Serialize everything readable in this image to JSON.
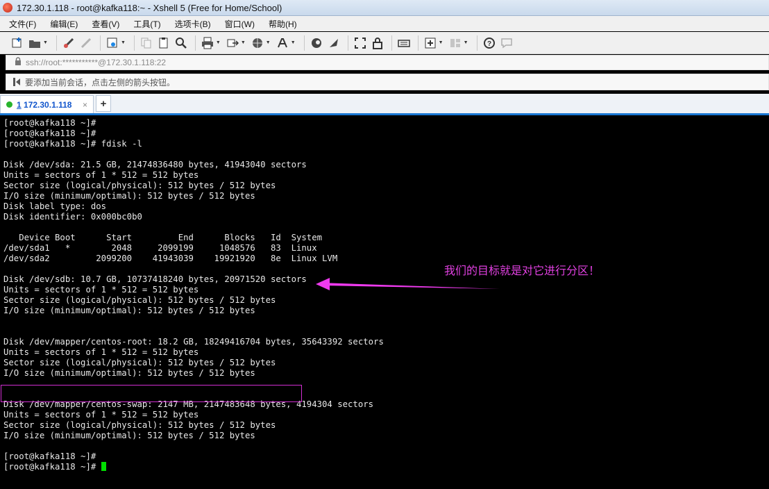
{
  "window": {
    "title": "172.30.1.118 - root@kafka118:~ - Xshell 5 (Free for Home/School)"
  },
  "menu": [
    "文件(F)",
    "编辑(E)",
    "查看(V)",
    "工具(T)",
    "选项卡(B)",
    "窗口(W)",
    "帮助(H)"
  ],
  "toolbar": {
    "icons": [
      "new-session-icon",
      "open-folder-icon",
      "connect-icon",
      "disconnect-icon",
      "properties-icon",
      "copy-icon",
      "paste-icon",
      "find-icon",
      "print-icon",
      "transfer-icon",
      "globe-icon",
      "font-icon",
      "xftp-icon",
      "xmanager-icon",
      "fullscreen-icon",
      "lock-icon",
      "keyboard-icon",
      "compose-icon",
      "layout-icon",
      "help-icon",
      "chat-icon"
    ]
  },
  "address": {
    "text": "ssh://root:***********@172.30.1.118:22"
  },
  "hint": {
    "text": "要添加当前会话，点击左侧的箭头按钮。"
  },
  "tabs": [
    {
      "number": "1",
      "label": "172.30.1.118",
      "close": "×"
    }
  ],
  "tab_add": "+",
  "terminal": {
    "lines": [
      "[root@kafka118 ~]#",
      "[root@kafka118 ~]#",
      "[root@kafka118 ~]# fdisk -l",
      "",
      "Disk /dev/sda: 21.5 GB, 21474836480 bytes, 41943040 sectors",
      "Units = sectors of 1 * 512 = 512 bytes",
      "Sector size (logical/physical): 512 bytes / 512 bytes",
      "I/O size (minimum/optimal): 512 bytes / 512 bytes",
      "Disk label type: dos",
      "Disk identifier: 0x000bc0b0",
      "",
      "   Device Boot      Start         End      Blocks   Id  System",
      "/dev/sda1   *        2048     2099199     1048576   83  Linux",
      "/dev/sda2         2099200    41943039    19921920   8e  Linux LVM",
      "",
      "Disk /dev/sdb: 10.7 GB, 10737418240 bytes, 20971520 sectors",
      "Units = sectors of 1 * 512 = 512 bytes",
      "Sector size (logical/physical): 512 bytes / 512 bytes",
      "I/O size (minimum/optimal): 512 bytes / 512 bytes",
      "",
      "",
      "Disk /dev/mapper/centos-root: 18.2 GB, 18249416704 bytes, 35643392 sectors",
      "Units = sectors of 1 * 512 = 512 bytes",
      "Sector size (logical/physical): 512 bytes / 512 bytes",
      "I/O size (minimum/optimal): 512 bytes / 512 bytes",
      "",
      "",
      "Disk /dev/mapper/centos-swap: 2147 MB, 2147483648 bytes, 4194304 sectors",
      "Units = sectors of 1 * 512 = 512 bytes",
      "Sector size (logical/physical): 512 bytes / 512 bytes",
      "I/O size (minimum/optimal): 512 bytes / 512 bytes",
      "",
      "[root@kafka118 ~]#",
      "[root@kafka118 ~]# "
    ],
    "cursor_color": "#00e000"
  },
  "annotation": {
    "text": "我们的目标就是对它进行分区！",
    "color": "#e040e0"
  }
}
